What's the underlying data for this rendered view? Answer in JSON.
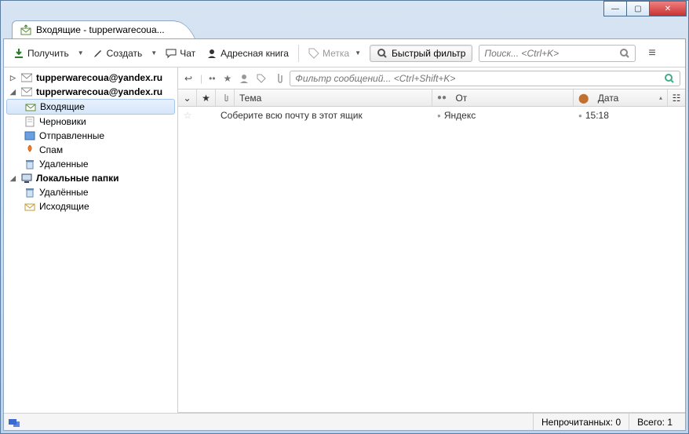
{
  "window": {
    "tab_title": "Входящие - tupperwarecoua..."
  },
  "toolbar": {
    "get": "Получить",
    "compose": "Создать",
    "chat": "Чат",
    "address": "Адресная книга",
    "tag": "Метка",
    "quickfilter": "Быстрый фильтр",
    "search_placeholder": "Поиск... <Ctrl+K>"
  },
  "tree": {
    "accounts": [
      {
        "email": "tupperwarecoua@yandex.ru",
        "expanded": false,
        "bold": true
      },
      {
        "email": "tupperwarecoua@yandex.ru",
        "expanded": true,
        "bold": true,
        "folders": [
          {
            "name": "Входящие",
            "selected": true,
            "icon": "inbox"
          },
          {
            "name": "Черновики",
            "icon": "drafts"
          },
          {
            "name": "Отправленные",
            "icon": "sent"
          },
          {
            "name": "Спам",
            "icon": "spam"
          },
          {
            "name": "Удаленные",
            "icon": "trash"
          }
        ]
      }
    ],
    "local_label": "Локальные папки",
    "local_folders": [
      {
        "name": "Удалённые",
        "icon": "trash"
      },
      {
        "name": "Исходящие",
        "icon": "outbox"
      }
    ]
  },
  "qfbar": {
    "filter_placeholder": "Фильтр сообщений... <Ctrl+Shift+K>"
  },
  "columns": {
    "subject": "Тема",
    "from": "От",
    "date": "Дата"
  },
  "messages": [
    {
      "subject": "Соберите всю почту в этот ящик",
      "from": "Яндекс",
      "date": "15:18"
    }
  ],
  "status": {
    "unread_label": "Непрочитанных:",
    "unread": "0",
    "total_label": "Всего:",
    "total": "1"
  }
}
